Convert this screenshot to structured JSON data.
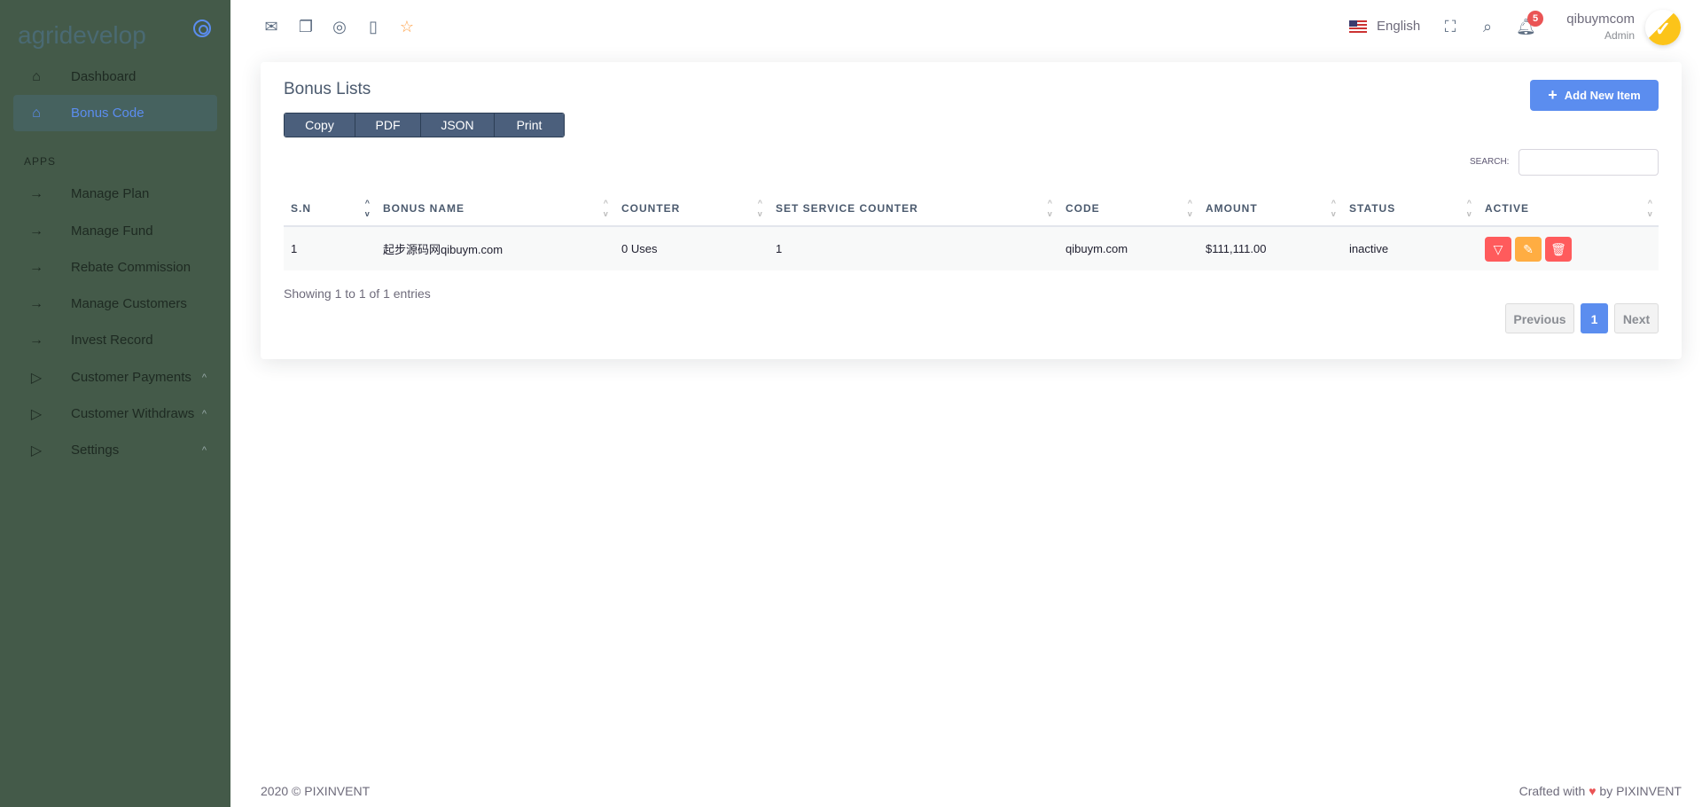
{
  "sidebar": {
    "logo": "agridevelop",
    "section": "APPS",
    "items": [
      {
        "label": "Dashboard",
        "icon": "home-icon"
      },
      {
        "label": "Bonus Code",
        "icon": "home-icon"
      },
      {
        "label": "Manage Plan",
        "icon": "arrow-right-icon"
      },
      {
        "label": "Manage Fund",
        "icon": "arrow-right-icon"
      },
      {
        "label": "Rebate Commission",
        "icon": "arrow-right-icon"
      },
      {
        "label": "Manage Customers",
        "icon": "arrow-right-icon"
      },
      {
        "label": "Invest Record",
        "icon": "arrow-right-icon"
      },
      {
        "label": "Customer Payments",
        "icon": "play-icon"
      },
      {
        "label": "Customer Withdraws",
        "icon": "play-icon"
      },
      {
        "label": "Settings",
        "icon": "play-icon"
      }
    ]
  },
  "topbar": {
    "language": "English",
    "notifications": "5",
    "user_name": "qibuymcom",
    "user_role": "Admin"
  },
  "card": {
    "title": "Bonus Lists",
    "export": [
      "Copy",
      "PDF",
      "JSON",
      "Print"
    ],
    "add_label": "Add New Item",
    "search_label": "SEARCH:",
    "search_value": "",
    "columns": [
      "S.N",
      "BONUS NAME",
      "COUNTER",
      "SET SERVICE COUNTER",
      "CODE",
      "AMOUNT",
      "STATUS",
      "ACTIVE"
    ],
    "rows": [
      {
        "sn": "1",
        "name": "起步源码网qibuym.com",
        "counter": "0 Uses",
        "service": "1",
        "code": "qibuym.com",
        "amount": "$111,111.00",
        "status": "inactive"
      }
    ],
    "showing": "Showing 1 to 1 of 1 entries",
    "prev": "Previous",
    "page": "1",
    "next": "Next"
  },
  "footer": {
    "left": "2020 © PIXINVENT",
    "right_pre": "Crafted with",
    "right_post": "by PIXINVENT"
  },
  "colors": {
    "primary": "#5b8def",
    "danger": "#ff5b5c",
    "warning": "#ffad42",
    "sidebar": "#445a49"
  }
}
